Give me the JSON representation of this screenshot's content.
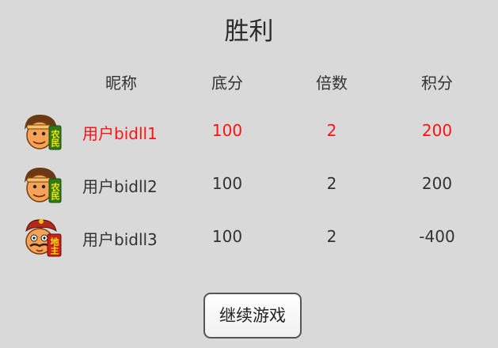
{
  "result": {
    "title": "胜利"
  },
  "table": {
    "headers": {
      "nickname": "昵称",
      "base_score": "底分",
      "multiplier": "倍数",
      "points": "积分"
    },
    "rows": [
      {
        "role": "农民",
        "avatar_icon": "farmer-avatar-icon",
        "nickname": "用户bidll1",
        "base_score": "100",
        "multiplier": "2",
        "points": "200",
        "highlighted": true
      },
      {
        "role": "农民",
        "avatar_icon": "farmer-avatar-icon",
        "nickname": "用户bidll2",
        "base_score": "100",
        "multiplier": "2",
        "points": "200",
        "highlighted": false
      },
      {
        "role": "地主",
        "avatar_icon": "landlord-avatar-icon",
        "nickname": "用户bidll3",
        "base_score": "100",
        "multiplier": "2",
        "points": "-400",
        "highlighted": false
      }
    ]
  },
  "actions": {
    "continue_label": "继续游戏"
  },
  "colors": {
    "background": "#d9d9d9",
    "highlight": "#ff1111",
    "text": "#333333",
    "badge_text": "#ffe400"
  }
}
